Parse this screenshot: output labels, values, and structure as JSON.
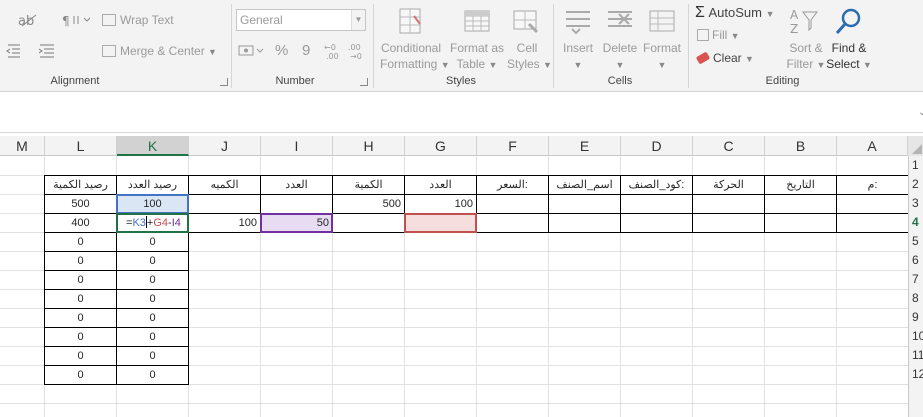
{
  "ribbon": {
    "alignment": {
      "group_label": "Alignment",
      "wrap_text": "Wrap Text",
      "merge_center": "Merge & Center"
    },
    "number": {
      "group_label": "Number",
      "format_value": "General",
      "percent_symbol": "%",
      "comma_symbol": "9"
    },
    "styles": {
      "group_label": "Styles",
      "conditional_formatting": [
        "Conditional",
        "Formatting"
      ],
      "format_as_table": [
        "Format as",
        "Table"
      ],
      "cell_styles": [
        "Cell",
        "Styles"
      ]
    },
    "cells": {
      "group_label": "Cells",
      "insert": "Insert",
      "delete": "Delete",
      "format": "Format"
    },
    "editing": {
      "group_label": "Editing",
      "autosum": "AutoSum",
      "fill": "Fill",
      "clear": "Clear",
      "sort_filter": [
        "Sort &",
        "Filter"
      ],
      "find_select": [
        "Find &",
        "Select"
      ]
    }
  },
  "grid": {
    "columns": [
      "M",
      "L",
      "K",
      "J",
      "I",
      "H",
      "G",
      "F",
      "E",
      "D",
      "C",
      "B",
      "A"
    ],
    "selected_column": "K",
    "row_numbers": [
      "1",
      "2",
      "3",
      "4",
      "5",
      "6",
      "7",
      "8",
      "9",
      "10",
      "11",
      "12"
    ],
    "selected_row": "4",
    "headers": {
      "L": "رصيد الكمية",
      "K": "رصيد العدد",
      "J": "الكميه",
      "I": "العدد",
      "H": "الكمية",
      "G": "العدد",
      "F": "السعر:",
      "E": "اسم_الصنف",
      "D": "كود_الصنف:",
      "C": "الحركة",
      "B": "التاريخ",
      "A": "م:"
    },
    "row3": {
      "L": "500",
      "K": "100",
      "H": "500",
      "G": "100"
    },
    "row4": {
      "L": "400",
      "J": "100",
      "I": "50"
    },
    "formula_parts": {
      "eq": "=",
      "k3": "K3",
      "plus": "+",
      "g4": "G4",
      "minus": "-",
      "i4": "I4"
    },
    "zeros_L": [
      "0",
      "0",
      "0",
      "0",
      "0",
      "0",
      "0",
      "0"
    ],
    "zeros_K": [
      "0",
      "0",
      "0",
      "0",
      "0",
      "0",
      "0",
      "0"
    ]
  },
  "colors": {
    "accent_green": "#217346",
    "ref_blue": "#4472c4",
    "ref_red": "#c0504d",
    "ref_purple": "#7030a0"
  }
}
